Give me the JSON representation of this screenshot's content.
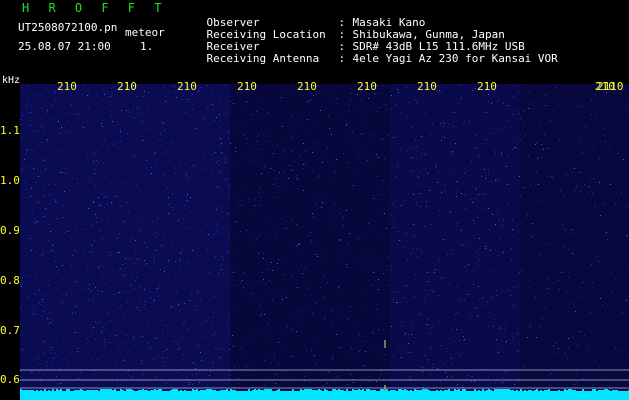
{
  "header": {
    "title": "H R O F F T",
    "filename": "UT2508072100.pn",
    "mode": "meteor",
    "datetime": "25.08.07 21:00",
    "counter": "1."
  },
  "info": [
    {
      "label": "Observer",
      "value": "Masaki Kano"
    },
    {
      "label": "Receiving Location",
      "value": "Shibukawa, Gunma, Japan"
    },
    {
      "label": "Receiver",
      "value": "SDR# 43dB L15 111.6MHz USB"
    },
    {
      "label": "Receiving Antenna",
      "value": "4ele Yagi Az 230 for Kansai VOR"
    }
  ],
  "axis": {
    "y_unit": "kHz",
    "y_ticks": [
      "1.1",
      "1.0",
      "0.9",
      "0.8",
      "0.7",
      "0.6"
    ],
    "x_ticks": [
      "210",
      "210",
      "210",
      "210",
      "210",
      "210",
      "210",
      "210",
      "210",
      "2110"
    ]
  },
  "colors": {
    "background": "#07073a",
    "text": "#ffffff",
    "title": "#22dd22",
    "ticks": "#ffff33",
    "baseline": "#00e5ff"
  }
}
